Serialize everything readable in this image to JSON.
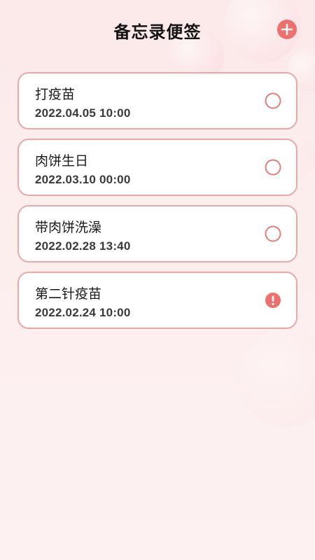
{
  "header": {
    "title": "备忘录便签",
    "add_icon": "plus-icon"
  },
  "colors": {
    "accent": "#ef6f6c",
    "card_border": "#eca8a8",
    "background": "#fdeeee"
  },
  "memos": [
    {
      "title": "打疫苗",
      "time": "2022.04.05 10:00",
      "status": "pending",
      "status_icon": "circle-icon"
    },
    {
      "title": "肉饼生日",
      "time": "2022.03.10 00:00",
      "status": "pending",
      "status_icon": "circle-icon"
    },
    {
      "title": "带肉饼洗澡",
      "time": "2022.02.28 13:40",
      "status": "pending",
      "status_icon": "circle-icon"
    },
    {
      "title": "第二针疫苗",
      "time": "2022.02.24 10:00",
      "status": "overdue",
      "status_icon": "alert-icon"
    }
  ]
}
